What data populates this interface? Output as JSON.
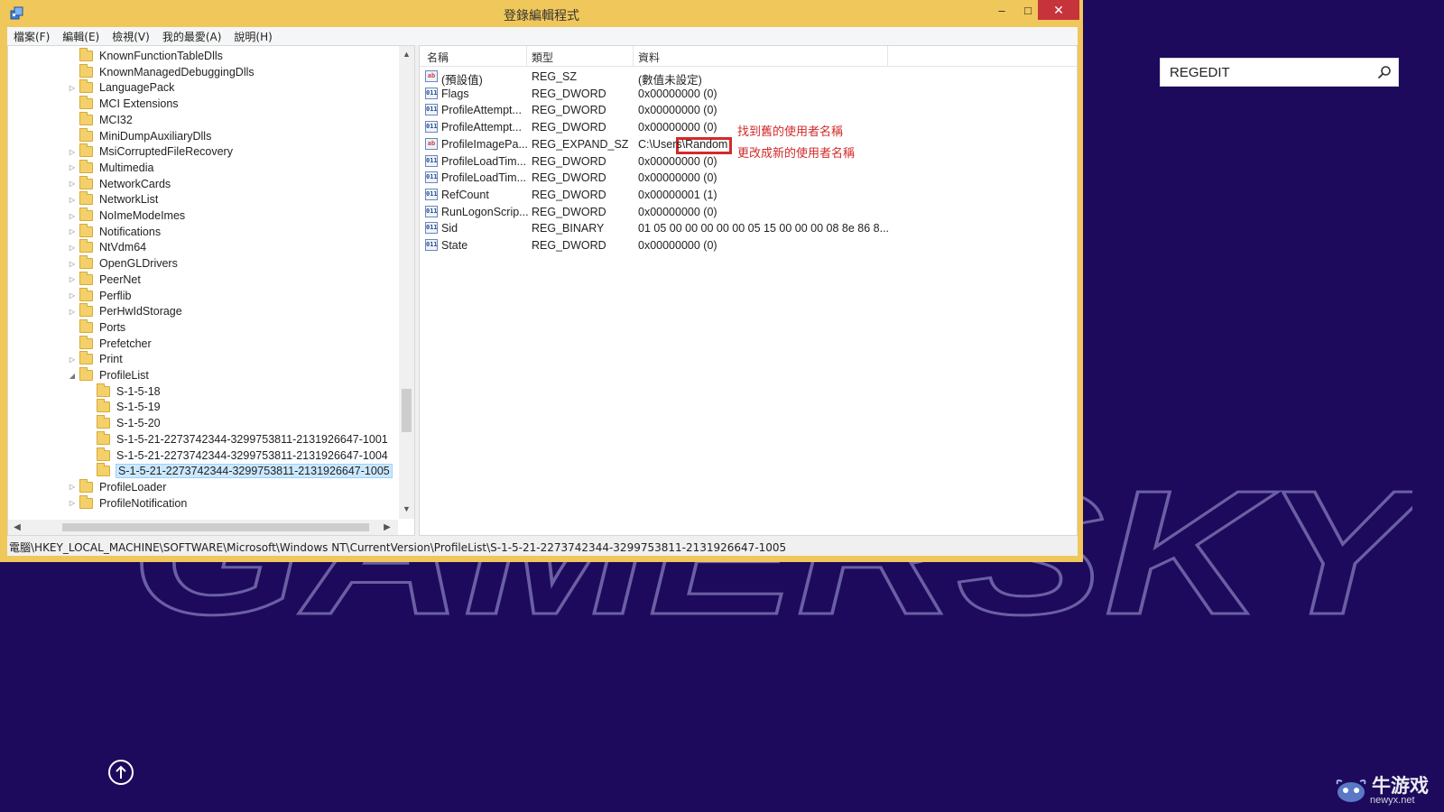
{
  "window": {
    "title": "登錄編輯程式",
    "minimize_glyph": "–",
    "maximize_glyph": "□",
    "close_glyph": "✕"
  },
  "menu": [
    "檔案(F)",
    "編輯(E)",
    "檢視(V)",
    "我的最愛(A)",
    "說明(H)"
  ],
  "tree": {
    "items": [
      {
        "label": "KnownFunctionTableDlls",
        "level": 1,
        "expander": ""
      },
      {
        "label": "KnownManagedDebuggingDlls",
        "level": 1,
        "expander": ""
      },
      {
        "label": "LanguagePack",
        "level": 1,
        "expander": "▷"
      },
      {
        "label": "MCI Extensions",
        "level": 1,
        "expander": ""
      },
      {
        "label": "MCI32",
        "level": 1,
        "expander": ""
      },
      {
        "label": "MiniDumpAuxiliaryDlls",
        "level": 1,
        "expander": ""
      },
      {
        "label": "MsiCorruptedFileRecovery",
        "level": 1,
        "expander": "▷"
      },
      {
        "label": "Multimedia",
        "level": 1,
        "expander": "▷"
      },
      {
        "label": "NetworkCards",
        "level": 1,
        "expander": "▷"
      },
      {
        "label": "NetworkList",
        "level": 1,
        "expander": "▷"
      },
      {
        "label": "NoImeModeImes",
        "level": 1,
        "expander": "▷"
      },
      {
        "label": "Notifications",
        "level": 1,
        "expander": "▷"
      },
      {
        "label": "NtVdm64",
        "level": 1,
        "expander": "▷"
      },
      {
        "label": "OpenGLDrivers",
        "level": 1,
        "expander": "▷"
      },
      {
        "label": "PeerNet",
        "level": 1,
        "expander": "▷"
      },
      {
        "label": "Perflib",
        "level": 1,
        "expander": "▷"
      },
      {
        "label": "PerHwIdStorage",
        "level": 1,
        "expander": "▷"
      },
      {
        "label": "Ports",
        "level": 1,
        "expander": ""
      },
      {
        "label": "Prefetcher",
        "level": 1,
        "expander": ""
      },
      {
        "label": "Print",
        "level": 1,
        "expander": "▷"
      },
      {
        "label": "ProfileList",
        "level": 1,
        "expander": "◢"
      },
      {
        "label": "S-1-5-18",
        "level": 2,
        "expander": ""
      },
      {
        "label": "S-1-5-19",
        "level": 2,
        "expander": ""
      },
      {
        "label": "S-1-5-20",
        "level": 2,
        "expander": ""
      },
      {
        "label": "S-1-5-21-2273742344-3299753811-2131926647-1001",
        "level": 2,
        "expander": ""
      },
      {
        "label": "S-1-5-21-2273742344-3299753811-2131926647-1004",
        "level": 2,
        "expander": ""
      },
      {
        "label": "S-1-5-21-2273742344-3299753811-2131926647-1005",
        "level": 2,
        "expander": "",
        "selected": true
      },
      {
        "label": "ProfileLoader",
        "level": 1,
        "expander": "▷"
      },
      {
        "label": "ProfileNotification",
        "level": 1,
        "expander": "▷"
      }
    ]
  },
  "list": {
    "headers": {
      "name": "名稱",
      "type": "類型",
      "data": "資料"
    },
    "rows": [
      {
        "icon": "ab",
        "name": "(預設值)",
        "type": "REG_SZ",
        "data": "(數值未設定)"
      },
      {
        "icon": "bin",
        "name": "Flags",
        "type": "REG_DWORD",
        "data": "0x00000000 (0)"
      },
      {
        "icon": "bin",
        "name": "ProfileAttempt...",
        "type": "REG_DWORD",
        "data": "0x00000000 (0)"
      },
      {
        "icon": "bin",
        "name": "ProfileAttempt...",
        "type": "REG_DWORD",
        "data": "0x00000000 (0)"
      },
      {
        "icon": "ab",
        "name": "ProfileImagePa...",
        "type": "REG_EXPAND_SZ",
        "data": "C:\\Users\\Random"
      },
      {
        "icon": "bin",
        "name": "ProfileLoadTim...",
        "type": "REG_DWORD",
        "data": "0x00000000 (0)"
      },
      {
        "icon": "bin",
        "name": "ProfileLoadTim...",
        "type": "REG_DWORD",
        "data": "0x00000000 (0)"
      },
      {
        "icon": "bin",
        "name": "RefCount",
        "type": "REG_DWORD",
        "data": "0x00000001 (1)"
      },
      {
        "icon": "bin",
        "name": "RunLogonScrip...",
        "type": "REG_DWORD",
        "data": "0x00000000 (0)"
      },
      {
        "icon": "bin",
        "name": "Sid",
        "type": "REG_BINARY",
        "data": "01 05 00 00 00 00 00 05 15 00 00 00 08 8e 86 8..."
      },
      {
        "icon": "bin",
        "name": "State",
        "type": "REG_DWORD",
        "data": "0x00000000 (0)"
      }
    ],
    "icon_text": {
      "ab": "ab",
      "bin": "011"
    }
  },
  "annotations": {
    "line1": "找到舊的使用者名稱",
    "line2": "更改成新的使用者名稱",
    "color": "#d32a2a"
  },
  "statusbar": {
    "path": "電腦\\HKEY_LOCAL_MACHINE\\SOFTWARE\\Microsoft\\Windows NT\\CurrentVersion\\ProfileList\\S-1-5-21-2273742344-3299753811-2131926647-1005"
  },
  "search": {
    "value": "REGEDIT"
  },
  "watermark": {
    "text": "GAMERSKY"
  },
  "brand": {
    "name": "牛游戏",
    "url": "newyx.net"
  },
  "colors": {
    "desktop": "#1d0a5c",
    "title_bar": "#f0c75a",
    "close": "#c7333a",
    "selection": "#cce8ff"
  }
}
